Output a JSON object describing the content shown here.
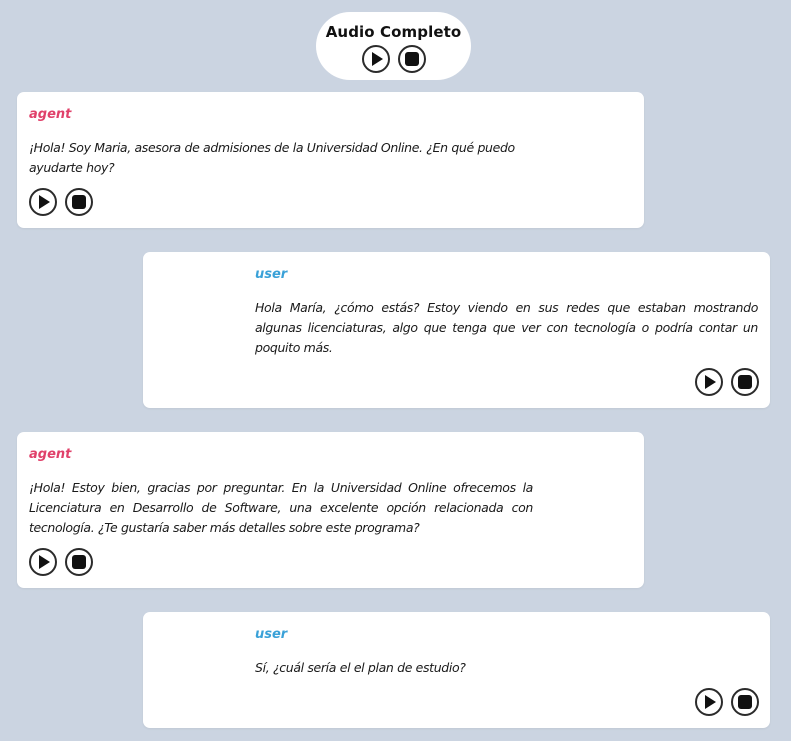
{
  "header": {
    "title": "Audio Completo",
    "controls": [
      "play-icon",
      "stop-icon"
    ]
  },
  "messages": [
    {
      "role": "agent",
      "text": "¡Hola! Soy Maria, asesora de admisiones de la Universidad Online. ¿En qué puedo ayudarte hoy?"
    },
    {
      "role": "user",
      "text": "Hola María, ¿cómo estás? Estoy viendo en sus redes que estaban mostrando algunas licenciaturas, algo que tenga que ver con tecnología o podría contar un poquito más."
    },
    {
      "role": "agent",
      "text": "¡Hola! Estoy bien, gracias por preguntar. En la Universidad Online ofrecemos la Licenciatura en Desarrollo de Software, una excelente opción relacionada con tecnología. ¿Te gustaría saber más detalles sobre este programa?"
    },
    {
      "role": "user",
      "text": "Sí, ¿cuál sería el el plan de estudio?"
    }
  ],
  "colors": {
    "background": "#cbd4e1",
    "agent_role": "#e0416a",
    "user_role": "#3aa1d8",
    "card": "#ffffff"
  }
}
